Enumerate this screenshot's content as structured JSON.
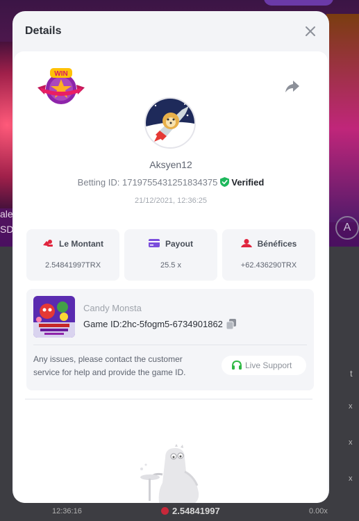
{
  "modal": {
    "title": "Details"
  },
  "bet": {
    "username": "Aksyen12",
    "betting_id_label": "Betting ID: 1719755431251834375",
    "verified_label": "Verified",
    "timestamp": "21/12/2021, 12:36:25"
  },
  "stats": [
    {
      "label": "Le Montant",
      "value": "2.54841997TRX",
      "icon": "coins-icon"
    },
    {
      "label": "Payout",
      "value": "25.5 x",
      "icon": "card-icon"
    },
    {
      "label": "Bénéfices",
      "value": "+62.436290TRX",
      "icon": "profit-icon"
    }
  ],
  "game": {
    "name": "Candy Monsta",
    "id_label": "Game ID:2hc-5fogm5-6734901862",
    "issue_text": "Any issues, please contact the customer service for help and provide the game ID.",
    "live_support_label": "Live Support"
  },
  "background": {
    "left_text_1": "ale",
    "left_text_2": "SD",
    "right_text_1": "t",
    "right_text_2": "x",
    "right_text_3": "x",
    "right_text_4": "x",
    "row_time": "12:36:16",
    "row_amount": "2.54841997",
    "row_multiplier": "0.00x",
    "circle_glyph": "A"
  },
  "colors": {
    "accent_red": "#e0253e",
    "verified_green": "#1eb85c",
    "payout_purple": "#7b4ddc",
    "live_support_green": "#2fb843"
  }
}
